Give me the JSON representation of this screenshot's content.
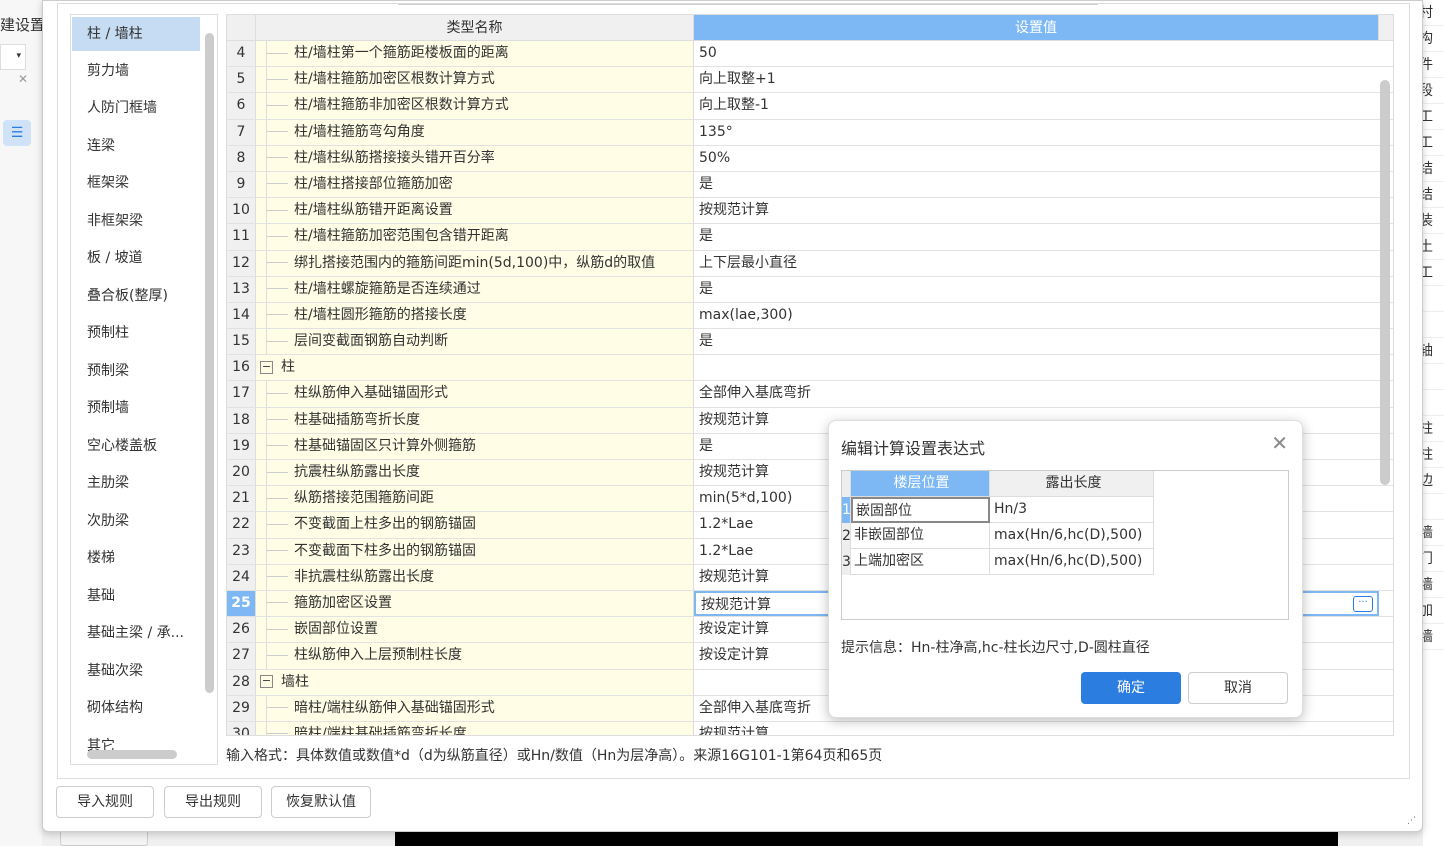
{
  "background": {
    "left_title": "建设置",
    "left_combo_text": "村",
    "right_items": [
      "构",
      "件",
      "段",
      "工",
      "工",
      "结",
      "结",
      "装",
      "土",
      "工",
      "",
      "",
      "轴",
      "",
      "",
      "柱",
      "柱",
      "边",
      "",
      "墙",
      "门",
      "墙",
      "加",
      "墙"
    ]
  },
  "sidebar": {
    "items": [
      "柱 / 墙柱",
      "剪力墙",
      "人防门框墙",
      "连梁",
      "框架梁",
      "非框架梁",
      "板 / 坡道",
      "叠合板(整厚)",
      "预制柱",
      "预制梁",
      "预制墙",
      "空心楼盖板",
      "主肋梁",
      "次肋梁",
      "楼梯",
      "基础",
      "基础主梁 / 承...",
      "基础次梁",
      "砌体结构",
      "其它"
    ],
    "selected": 0
  },
  "grid": {
    "headers": [
      "类型名称",
      "设置值"
    ],
    "rows": [
      {
        "n": "4",
        "name": "柱/墙柱第一个箍筋距楼板面的距离",
        "value": "50"
      },
      {
        "n": "5",
        "name": "柱/墙柱箍筋加密区根数计算方式",
        "value": "向上取整+1"
      },
      {
        "n": "6",
        "name": "柱/墙柱箍筋非加密区根数计算方式",
        "value": "向上取整-1"
      },
      {
        "n": "7",
        "name": "柱/墙柱箍筋弯勾角度",
        "value": "135°"
      },
      {
        "n": "8",
        "name": "柱/墙柱纵筋搭接接头错开百分率",
        "value": "50%"
      },
      {
        "n": "9",
        "name": "柱/墙柱搭接部位箍筋加密",
        "value": "是"
      },
      {
        "n": "10",
        "name": "柱/墙柱纵筋错开距离设置",
        "value": "按规范计算"
      },
      {
        "n": "11",
        "name": "柱/墙柱箍筋加密范围包含错开距离",
        "value": "是"
      },
      {
        "n": "12",
        "name": "绑扎搭接范围内的箍筋间距min(5d,100)中，纵筋d的取值",
        "value": "上下层最小直径"
      },
      {
        "n": "13",
        "name": "柱/墙柱螺旋箍筋是否连续通过",
        "value": "是"
      },
      {
        "n": "14",
        "name": "柱/墙柱圆形箍筋的搭接长度",
        "value": "max(lae,300)"
      },
      {
        "n": "15",
        "name": "层间变截面钢筋自动判断",
        "value": "是"
      },
      {
        "n": "16",
        "name": "柱",
        "value": "",
        "group": true
      },
      {
        "n": "17",
        "name": "柱纵筋伸入基础锚固形式",
        "value": "全部伸入基底弯折"
      },
      {
        "n": "18",
        "name": "柱基础插筋弯折长度",
        "value": "按规范计算"
      },
      {
        "n": "19",
        "name": "柱基础锚固区只计算外侧箍筋",
        "value": "是"
      },
      {
        "n": "20",
        "name": "抗震柱纵筋露出长度",
        "value": "按规范计算"
      },
      {
        "n": "21",
        "name": "纵筋搭接范围箍筋间距",
        "value": "min(5*d,100)"
      },
      {
        "n": "22",
        "name": "不变截面上柱多出的钢筋锚固",
        "value": "1.2*Lae"
      },
      {
        "n": "23",
        "name": "不变截面下柱多出的钢筋锚固",
        "value": "1.2*Lae"
      },
      {
        "n": "24",
        "name": "非抗震柱纵筋露出长度",
        "value": "按规范计算"
      },
      {
        "n": "25",
        "name": "箍筋加密区设置",
        "value": "按规范计算",
        "active": true
      },
      {
        "n": "26",
        "name": "嵌固部位设置",
        "value": "按设定计算"
      },
      {
        "n": "27",
        "name": "柱纵筋伸入上层预制柱长度",
        "value": "按设定计算"
      },
      {
        "n": "28",
        "name": "墙柱",
        "value": "",
        "group": true
      },
      {
        "n": "29",
        "name": "暗柱/端柱纵筋伸入基础锚固形式",
        "value": "全部伸入基底弯折"
      },
      {
        "n": "30",
        "name": "暗柱/端柱基础插筋弯折长度",
        "value": "按规范计算"
      }
    ]
  },
  "hint": "输入格式：具体数值或数值*d（d为纵筋直径）或Hn/数值（Hn为层净高）。来源16G101-1第64页和65页",
  "buttons": {
    "import": "导入规则",
    "export": "导出规则",
    "restore": "恢复默认值"
  },
  "modal": {
    "title": "编辑计算设置表达式",
    "headers": [
      "楼层位置",
      "露出长度"
    ],
    "rows": [
      {
        "n": "1",
        "pos": "嵌固部位",
        "len": "Hn/3"
      },
      {
        "n": "2",
        "pos": "非嵌固部位",
        "len": "max(Hn/6,hc(D),500)"
      },
      {
        "n": "3",
        "pos": "上端加密区",
        "len": "max(Hn/6,hc(D),500)"
      }
    ],
    "tip": "提示信息：Hn-柱净高,hc-柱长边尺寸,D-圆柱直径",
    "ok": "确定",
    "cancel": "取消"
  },
  "colors": {
    "accent": "#2b7de0",
    "header_selected": "#7db8f5",
    "name_cell_bg": "#fffde6",
    "sidebar_selected": "#c5dcf3"
  }
}
